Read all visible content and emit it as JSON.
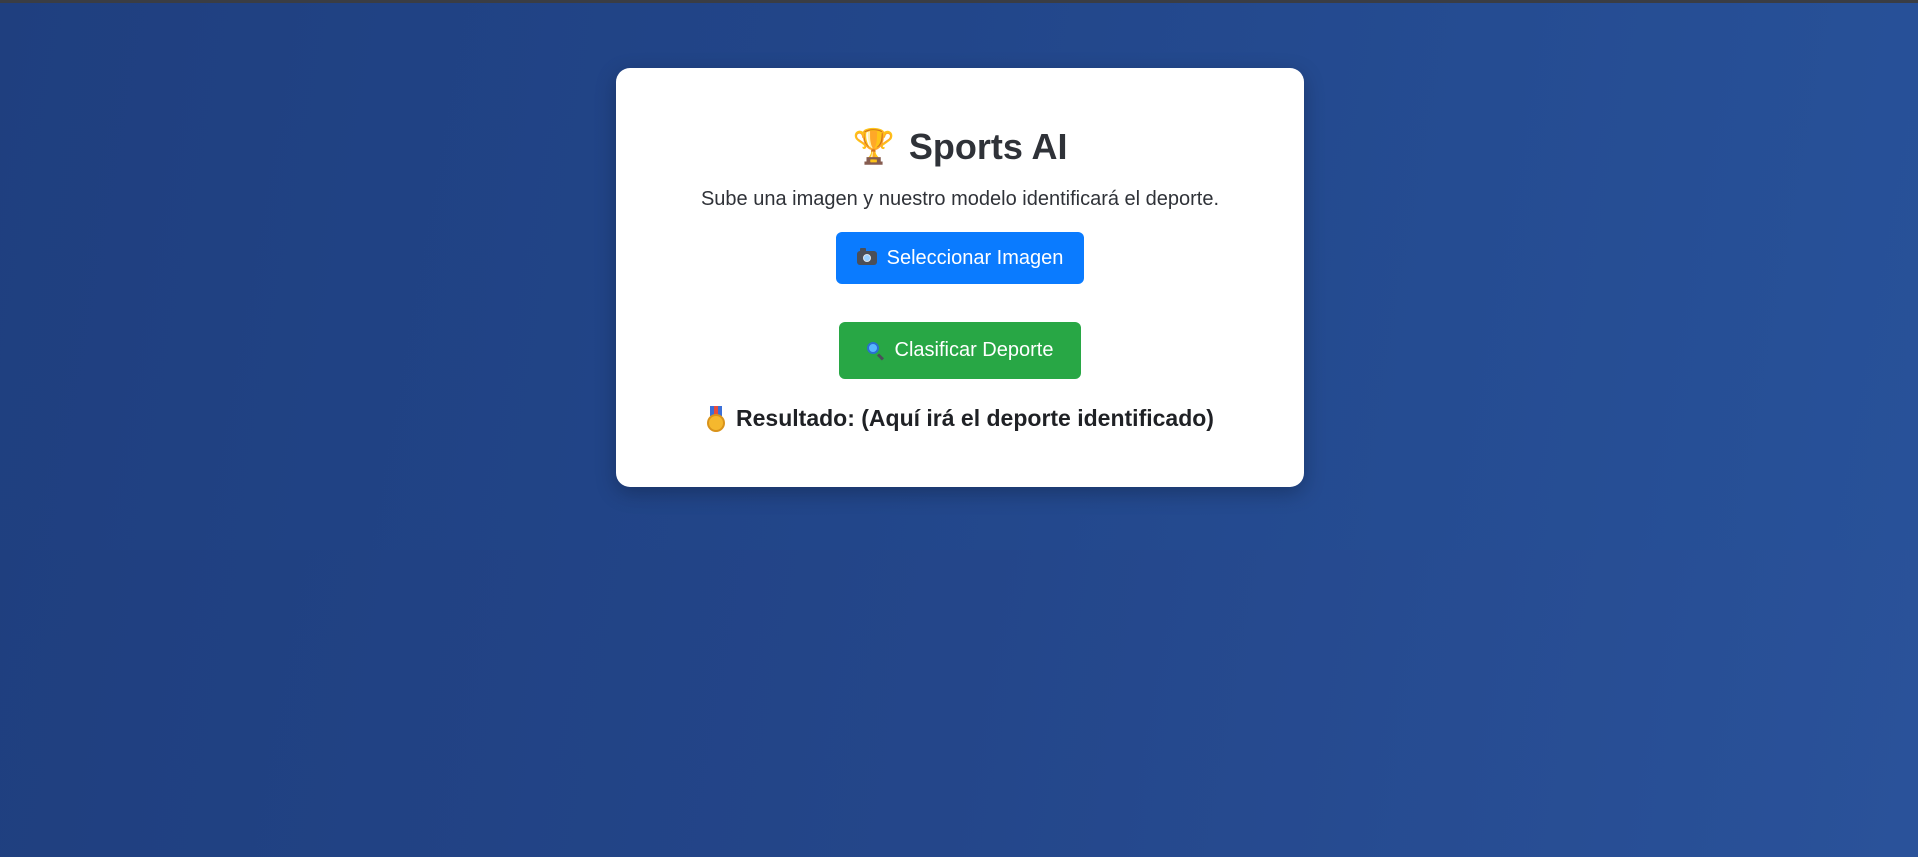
{
  "app": {
    "title": "Sports AI",
    "subtitle": "Sube una imagen y nuestro modelo identificará el deporte."
  },
  "actions": {
    "select_label": "Seleccionar Imagen",
    "classify_label": "Clasificar Deporte"
  },
  "result": {
    "text": "Resultado: (Aquí irá el deporte identificado)"
  },
  "icons": {
    "title": "trophy-icon",
    "select": "camera-icon",
    "classify": "magnifier-icon",
    "result": "medal-icon"
  },
  "colors": {
    "background": "#22468a",
    "card": "#ffffff",
    "select_button": "#0a7bff",
    "classify_button": "#28a745",
    "text": "#2f3238"
  }
}
